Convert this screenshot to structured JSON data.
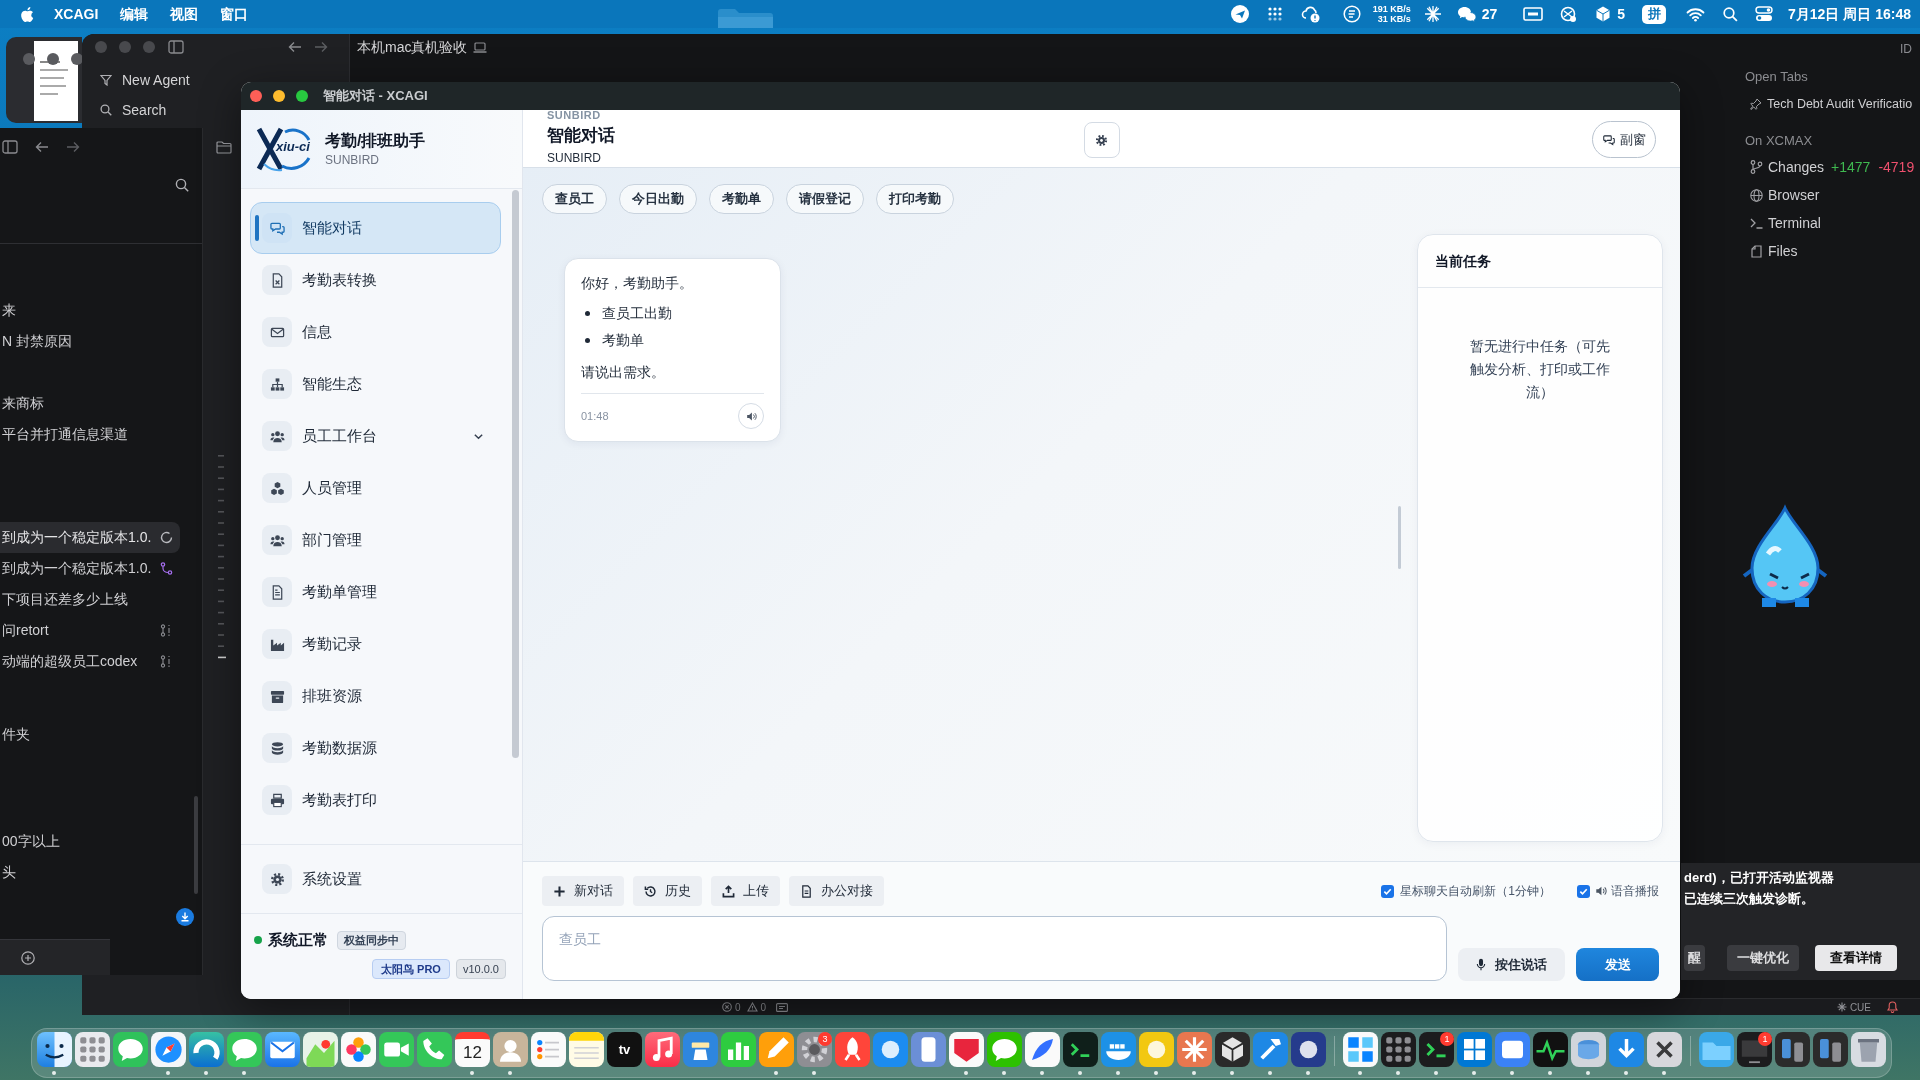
{
  "menu_bar": {
    "app_name": "XCAGI",
    "menus": [
      "编辑",
      "视图",
      "窗口"
    ],
    "upload_speed": "191 KB/s",
    "download_speed": "31 KB/s",
    "chat_count": "27",
    "package_count": "5",
    "input_method": "拼",
    "datetime": "7月12日 周日 16:48"
  },
  "agent_window": {
    "sidebar": [
      "New Agent",
      "Search"
    ],
    "title": "本机mac真机验收",
    "corner_label": "ID",
    "side_panel": {
      "open_tabs_heading": "Open Tabs",
      "open_tabs": [
        "Tech Debt Audit Verificatio"
      ],
      "workspace_heading": "On XCMAX",
      "items": [
        {
          "kind": "changes",
          "label": "Changes",
          "added": "+1477",
          "removed": "-4719"
        },
        {
          "kind": "browser",
          "label": "Browser"
        },
        {
          "kind": "terminal",
          "label": "Terminal"
        },
        {
          "kind": "files",
          "label": "Files"
        }
      ]
    },
    "status_bar": {
      "errors": "0",
      "warnings": "0",
      "right_label": "CUE"
    }
  },
  "task_list_window": {
    "groups": [
      {
        "items": [
          {
            "text": "来",
            "kind": "plain",
            "selected": false
          },
          {
            "text": "N 封禁原因",
            "kind": "plain",
            "selected": false
          }
        ]
      },
      {
        "items": [
          {
            "text": "来商标",
            "kind": "plain",
            "selected": false
          },
          {
            "text": "平台并打通信息渠道",
            "kind": "plain",
            "selected": false
          }
        ]
      },
      {
        "items": [
          {
            "text": "到成为一个稳定版本1.0.",
            "kind": "running",
            "selected": true
          },
          {
            "text": "到成为一个稳定版本1.0.",
            "kind": "branch",
            "selected": false
          },
          {
            "text": "下项目还差多少上线",
            "kind": "plain",
            "selected": false
          },
          {
            "text": "问retort",
            "kind": "pull_request",
            "selected": false
          },
          {
            "text": "动端的超级员工codex",
            "kind": "pull_request",
            "selected": false
          }
        ]
      },
      {
        "items": [
          {
            "text": "件夹",
            "kind": "plain",
            "selected": false
          }
        ]
      },
      {
        "items": [
          {
            "text": "00字以上",
            "kind": "plain",
            "selected": false
          },
          {
            "text": "头",
            "kind": "plain",
            "selected": false
          }
        ]
      }
    ]
  },
  "app_window": {
    "title": "智能对话 - XCAGI",
    "sidebar": {
      "logo_text": "xiu-ci",
      "app_title": "考勤/排班助手",
      "app_subtitle": "SUNBIRD",
      "items": [
        {
          "label": "智能对话",
          "selected": true,
          "kind": "link"
        },
        {
          "label": "考勤表转换",
          "selected": false,
          "kind": "link"
        },
        {
          "label": "信息",
          "selected": false,
          "kind": "link"
        },
        {
          "label": "智能生态",
          "selected": false,
          "kind": "link"
        },
        {
          "label": "员工工作台",
          "selected": false,
          "kind": "group"
        },
        {
          "label": "人员管理",
          "selected": false,
          "kind": "link"
        },
        {
          "label": "部门管理",
          "selected": false,
          "kind": "link"
        },
        {
          "label": "考勤单管理",
          "selected": false,
          "kind": "link"
        },
        {
          "label": "考勤记录",
          "selected": false,
          "kind": "link"
        },
        {
          "label": "排班资源",
          "selected": false,
          "kind": "link"
        },
        {
          "label": "考勤数据源",
          "selected": false,
          "kind": "link"
        },
        {
          "label": "考勤表打印",
          "selected": false,
          "kind": "link"
        }
      ],
      "settings": "系统设置",
      "status": {
        "label": "系统正常",
        "healthy": true,
        "sync_badge": "权益同步中"
      },
      "plan_badge": "太阳鸟 PRO",
      "version_badge": "v10.0.0"
    },
    "header": {
      "overline": "SUNBIRD",
      "title": "智能对话",
      "subtitle": "SUNBIRD",
      "popout_button": "副窗"
    },
    "quick_actions": [
      "查员工",
      "今日出勤",
      "考勤单",
      "请假登记",
      "打印考勤"
    ],
    "messages": [
      {
        "greeting": "你好，考勤助手。",
        "bullets": [
          "查员工出勤",
          "考勤单"
        ],
        "prompt": "请说出需求。",
        "time": "01:48"
      }
    ],
    "task_panel": {
      "title": "当前任务",
      "empty_text": "暂无进行中任务（可先触发分析、打印或工作流）"
    },
    "toolbar": [
      "新对话",
      "历史",
      "上传",
      "办公对接"
    ],
    "options": [
      {
        "label": "星标聊天自动刷新（1分钟）",
        "checked": true,
        "kind": "plain"
      },
      {
        "label": "语音播报",
        "checked": true,
        "kind": "speaker"
      }
    ],
    "composer": {
      "placeholder": "查员工",
      "voice_button": "按住说话",
      "send_button": "发送"
    }
  },
  "notification": {
    "lines": [
      "derd)，已打开活动监视器",
      "已连续三次触发诊断。"
    ],
    "buttons": [
      {
        "label": "醒",
        "kind": "secondary"
      },
      {
        "label": "一键优化",
        "kind": "secondary"
      },
      {
        "label": "查看详情",
        "kind": "primary"
      }
    ]
  },
  "dock": {
    "items": [
      {
        "running": true
      },
      {
        "running": false
      },
      {
        "running": false
      },
      {
        "running": true
      },
      {
        "running": true
      },
      {
        "running": true
      },
      {
        "running": false
      },
      {
        "running": false
      },
      {
        "running": false
      },
      {
        "running": false
      },
      {
        "running": false
      },
      {
        "running": true,
        "label": "12"
      },
      {
        "running": true
      },
      {
        "running": false
      },
      {
        "running": false
      },
      {
        "running": false,
        "label": "tv"
      },
      {
        "running": false
      },
      {
        "running": false
      },
      {
        "running": false
      },
      {
        "running": true
      },
      {
        "running": true,
        "badge": "3"
      },
      {
        "running": false
      },
      {
        "running": false
      },
      {
        "running": false
      },
      {
        "running": true
      },
      {
        "running": true
      },
      {
        "running": true
      },
      {
        "running": true
      },
      {
        "running": true
      },
      {
        "running": true
      },
      {
        "running": true
      },
      {
        "running": true
      },
      {
        "running": true
      },
      {
        "running": true
      },
      {
        "running": true
      },
      {
        "running": true
      },
      {
        "running": true,
        "badge": "1"
      },
      {
        "running": true
      },
      {
        "running": true
      },
      {
        "running": true
      },
      {
        "running": true
      },
      {
        "running": true
      },
      {
        "running": true
      },
      {
        "running": false
      },
      {
        "running": false,
        "badge": "1"
      },
      {
        "running": false
      },
      {
        "running": false
      },
      {
        "running": false
      }
    ]
  }
}
